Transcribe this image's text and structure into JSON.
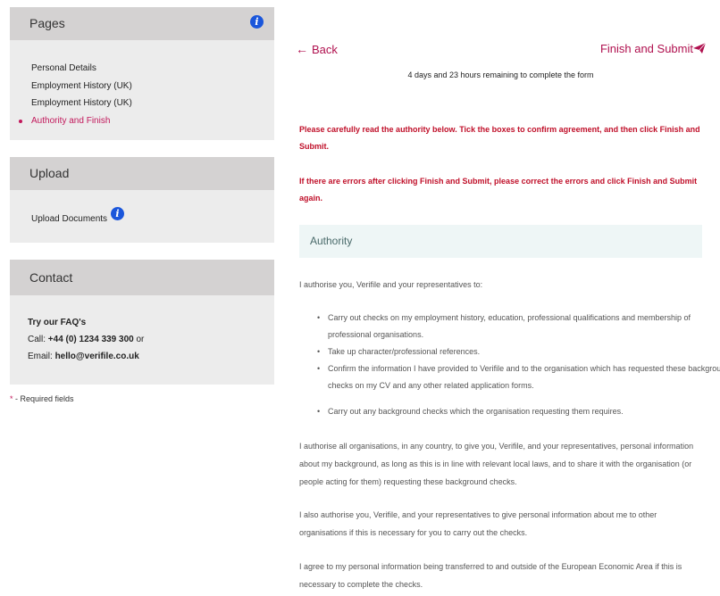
{
  "sidebar": {
    "pages": {
      "title": "Pages",
      "items": [
        {
          "label": "Personal Details"
        },
        {
          "label": "Employment History (UK)"
        },
        {
          "label": "Employment History (UK)"
        },
        {
          "label": "Authority and Finish"
        }
      ]
    },
    "upload": {
      "title": "Upload",
      "item": "Upload Documents"
    },
    "contact": {
      "title": "Contact",
      "faq": "Try our FAQ's",
      "call_prefix": "Call: ",
      "phone": "+44 (0) 1234 339 300",
      "call_suffix": " or",
      "email_prefix": "Email: ",
      "email": "hello@verifile.co.uk"
    },
    "required_star": "*",
    "required_text": " - Required fields"
  },
  "nav": {
    "back": "Back",
    "finish": "Finish and Submit"
  },
  "remaining": "4 days and 23 hours remaining to complete the form",
  "warnings": [
    "Please carefully read the authority below. Tick the boxes to confirm agreement, and then click Finish and Submit.",
    "If there are errors after clicking Finish and Submit, please correct the errors and click Finish and Submit again."
  ],
  "authority": {
    "title": "Authority",
    "intro": "I authorise you, Verifile and your representatives to:",
    "bullets": [
      "Carry out checks on my employment history, education, professional qualifications and membership of professional organisations.",
      "Take up character/professional references.",
      "Confirm the information I have provided to Verifile and to the organisation which has requested these background checks on my CV and any other related application forms.",
      "Carry out any background checks which the organisation requesting them requires."
    ],
    "paragraphs": [
      "I authorise all organisations, in any country, to give you, Verifile, and your representatives, personal information about my background, as long as this is in line with relevant local laws, and to share it with the organisation (or people acting for them) requesting these background checks.",
      "I also authorise you, Verifile, and your representatives to give personal information about me to other organisations if this is necessary for you to carry out the checks.",
      "I agree to my personal information being transferred to and outside of the European Economic Area if this is necessary to complete the checks."
    ]
  },
  "colors": {
    "accent": "#b0114f",
    "warning": "#c0102a",
    "info": "#1a56db"
  }
}
